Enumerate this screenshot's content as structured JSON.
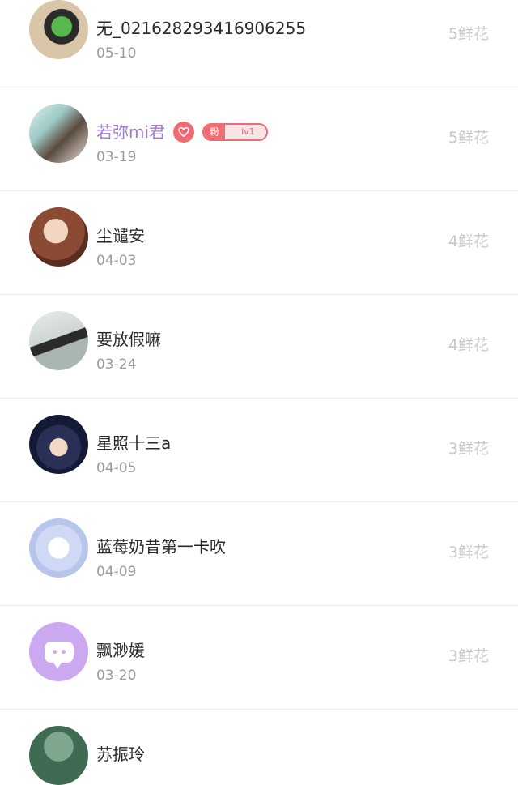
{
  "list": {
    "items": [
      {
        "name": "无_021628293416906255",
        "date": "05-10",
        "flowers": "5鲜花"
      },
      {
        "name": "若弥mi君",
        "date": "03-19",
        "flowers": "5鲜花",
        "badges": {
          "fan_label": "粉",
          "fan_level": "lv1"
        }
      },
      {
        "name": "尘谴安",
        "date": "04-03",
        "flowers": "4鲜花"
      },
      {
        "name": "要放假嘛",
        "date": "03-24",
        "flowers": "4鲜花"
      },
      {
        "name": "星照十三a",
        "date": "04-05",
        "flowers": "3鲜花"
      },
      {
        "name": "蓝莓奶昔第一卡吹",
        "date": "04-09",
        "flowers": "3鲜花"
      },
      {
        "name": "飘渺媛",
        "date": "03-20",
        "flowers": "3鲜花"
      },
      {
        "name": "苏振玲"
      }
    ]
  },
  "colors": {
    "vip_name": "#a07ad1",
    "badge_red": "#f06c74",
    "flowers_gray": "#c8c8c8",
    "date_gray": "#9b9b9b"
  },
  "icons": {
    "heart_badge": "heart-icon",
    "default_avatar": "chat-bubble-icon"
  }
}
